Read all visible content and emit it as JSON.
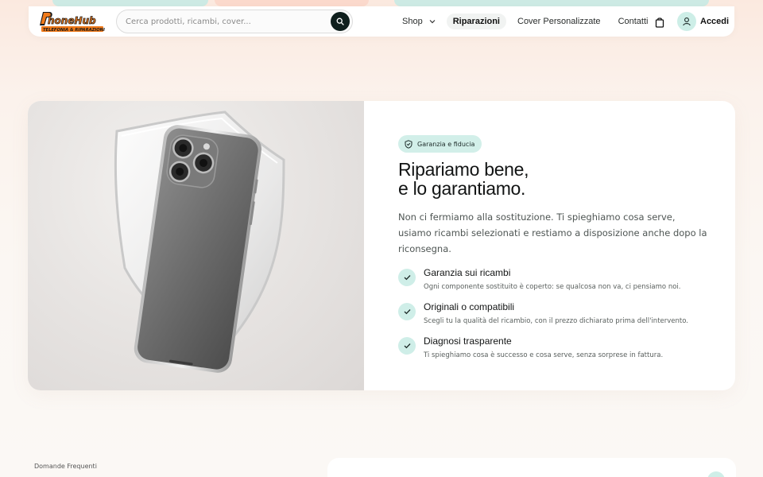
{
  "header": {
    "logo": {
      "brand": "PhoneHub",
      "tagline": "TELEFONIA & RIPARAZIONI"
    },
    "search": {
      "placeholder": "Cerca prodotti, ricambi, cover...",
      "value": ""
    },
    "nav": [
      {
        "label": "Shop",
        "has_dropdown": true,
        "active": false
      },
      {
        "label": "Riparazioni",
        "active": true
      },
      {
        "label": "Cover Personalizzate",
        "active": false
      },
      {
        "label": "Contatti",
        "active": false
      }
    ],
    "login_label": "Accedi"
  },
  "hero": {
    "badge": "Garanzia e fiducia",
    "title_line1": "Ripariamo bene,",
    "title_line2": "e lo garantiamo.",
    "subtitle": "Non ci fermiamo alla sostituzione. Ti spieghiamo cosa serve, usiamo ricambi selezionati e restiamo a disposizione anche dopo la riconsegna.",
    "features": [
      {
        "title": "Garanzia sui ricambi",
        "desc": "Ogni componente sostituito è coperto: se qualcosa non va, ci pensiamo noi."
      },
      {
        "title": "Originali o compatibili",
        "desc": "Scegli tu la qualità del ricambio, con il prezzo dichiarato prima dell'intervento."
      },
      {
        "title": "Diagnosi trasparente",
        "desc": "Ti spieghiamo cosa è successo e cosa serve, senza sorprese in fattura."
      }
    ]
  },
  "faq": {
    "label": "Domande Frequenti"
  },
  "colors": {
    "accent_mint": "#cfeee8",
    "brand_orange": "#f07a1a",
    "dark": "#0f1f1d"
  },
  "icons": {
    "search": "search-icon",
    "bag": "shopping-bag-icon",
    "user": "user-icon",
    "shield": "shield-check-icon",
    "check": "check-icon"
  }
}
